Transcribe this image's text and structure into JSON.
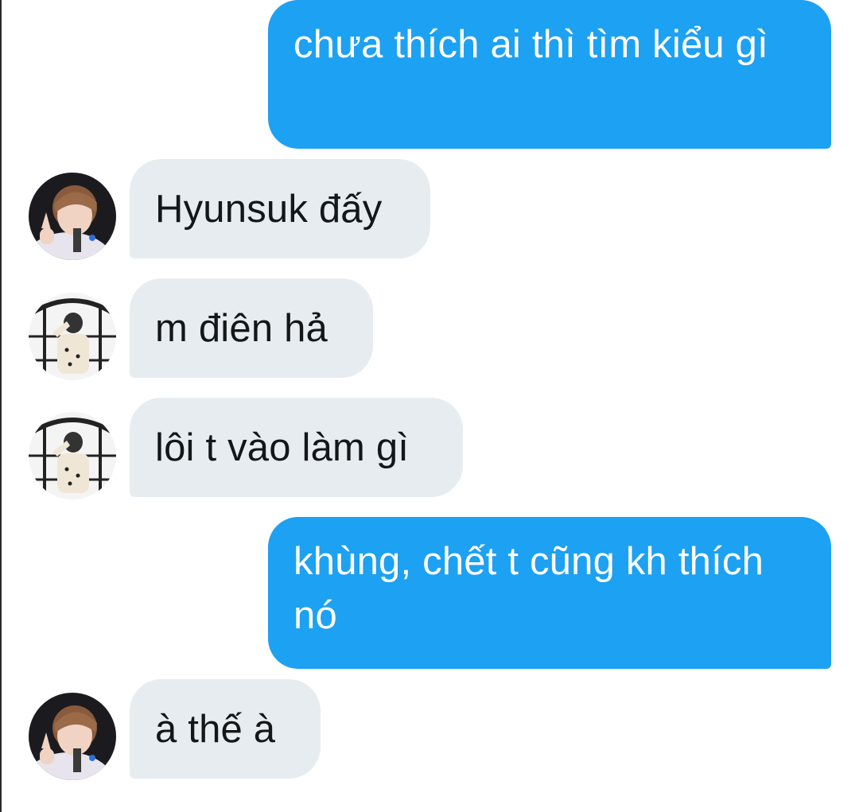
{
  "conversation": {
    "messages": [
      {
        "id": "m1",
        "side": "out",
        "text": "chưa thích ai thì tìm kiểu gì"
      },
      {
        "id": "m2",
        "side": "in",
        "avatar": "avatar-a-icon",
        "text": "Hyunsuk đấy"
      },
      {
        "id": "m3",
        "side": "in",
        "avatar": "avatar-b-icon",
        "text": "m điên hả"
      },
      {
        "id": "m4",
        "side": "in",
        "avatar": "avatar-b-icon",
        "text": "lôi t vào làm gì"
      },
      {
        "id": "m5",
        "side": "out",
        "text": "khùng, chết t cũng kh thích nó"
      },
      {
        "id": "m6",
        "side": "in",
        "avatar": "avatar-a-icon",
        "text": "à thế à"
      }
    ]
  },
  "colors": {
    "outgoing_bubble": "#1da1f2",
    "incoming_bubble": "#e6ecf0",
    "incoming_text": "#14171a",
    "outgoing_text": "#ffffff"
  }
}
